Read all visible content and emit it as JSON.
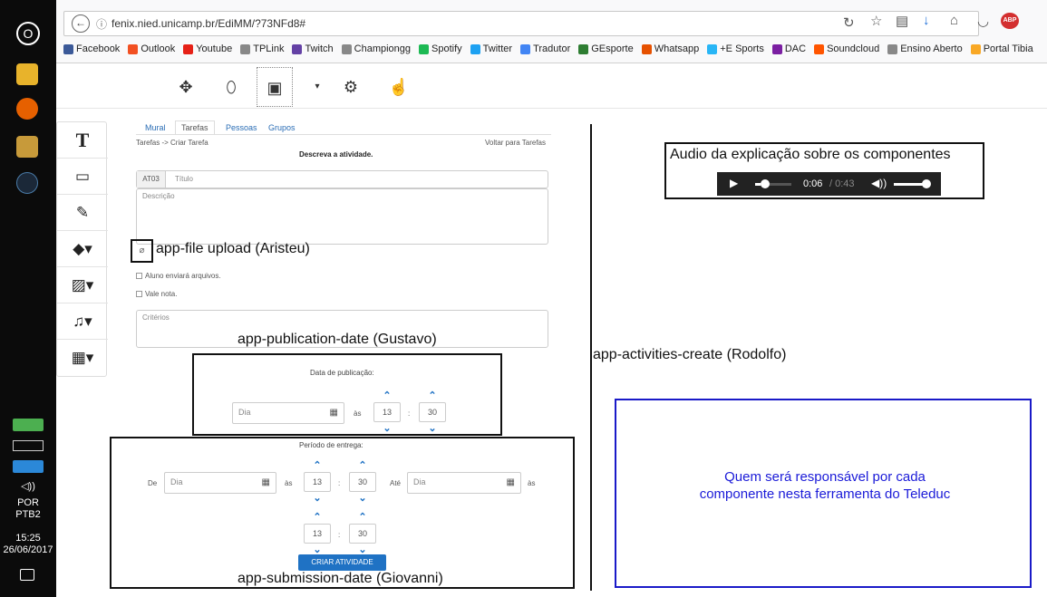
{
  "taskbar": {
    "start_label": "O",
    "tray": {
      "lang1": "POR",
      "lang2": "PTB2",
      "time": "15:25",
      "date": "26/06/2017"
    }
  },
  "browser": {
    "url": "fenix.nied.unicamp.br/EdiMM/?73NFd8#",
    "bookmarks": [
      "Facebook",
      "Outlook",
      "Youtube",
      "TPLink",
      "Twitch",
      "Championgg",
      "Spotify",
      "Twitter",
      "Tradutor",
      "GEsporte",
      "Whatsapp",
      "+E Sports",
      "DAC",
      "Soundcloud",
      "Ensino Aberto",
      "Portal Tibia"
    ],
    "bookmark_colors": [
      "#3b5998",
      "#f25022",
      "#e62117",
      "#888888",
      "#6441a5",
      "#888888",
      "#1db954",
      "#1da1f2",
      "#4285f4",
      "#2e7d32",
      "#e65100",
      "#29b6f6",
      "#7b1fa2",
      "#ff5500",
      "#888888",
      "#f9a825"
    ]
  },
  "form": {
    "tabs": [
      "Mural",
      "Tarefas",
      "Pessoas",
      "Grupos"
    ],
    "breadcrumb": "Tarefas -> Criar Tarefa",
    "back_link": "Voltar para Tarefas",
    "heading": "Descreva a atividade.",
    "code_value": "AT03",
    "title_placeholder": "Título",
    "description_placeholder": "Descrição",
    "check_upload": "Aluno enviará arquivos.",
    "check_grade": "Vale nota.",
    "criteria_placeholder": "Critérios",
    "publication": {
      "title": "Data de publicação:",
      "day_placeholder": "Dia",
      "at": "às",
      "hour": "13",
      "minute": "30"
    },
    "delivery": {
      "title": "Período de entrega:",
      "from": "De",
      "day_placeholder": "Dia",
      "at": "às",
      "hour1": "13",
      "minute1": "30",
      "until": "Até",
      "hour2": "13",
      "minute2": "30"
    },
    "submit_button": "CRIAR ATIVIDADE"
  },
  "annotations": {
    "file_upload": "app-file upload (Aristeu)",
    "publication_date": "app-publication-date (Gustavo)",
    "submission_date": "app-submission-date (Giovanni)",
    "activities_create": "app-activities-create (Rodolfo)",
    "audio_title": "Audio da explicação sobre os componentes",
    "audio_time": "0:06",
    "audio_duration": "/ 0:43",
    "blue_note": "Quem será responsável por cada componente nesta ferramenta do Teleduc"
  },
  "colors": {
    "accent": "#1f72c4",
    "note_border": "#1a1ac8",
    "note_text": "#1a1ad8"
  }
}
